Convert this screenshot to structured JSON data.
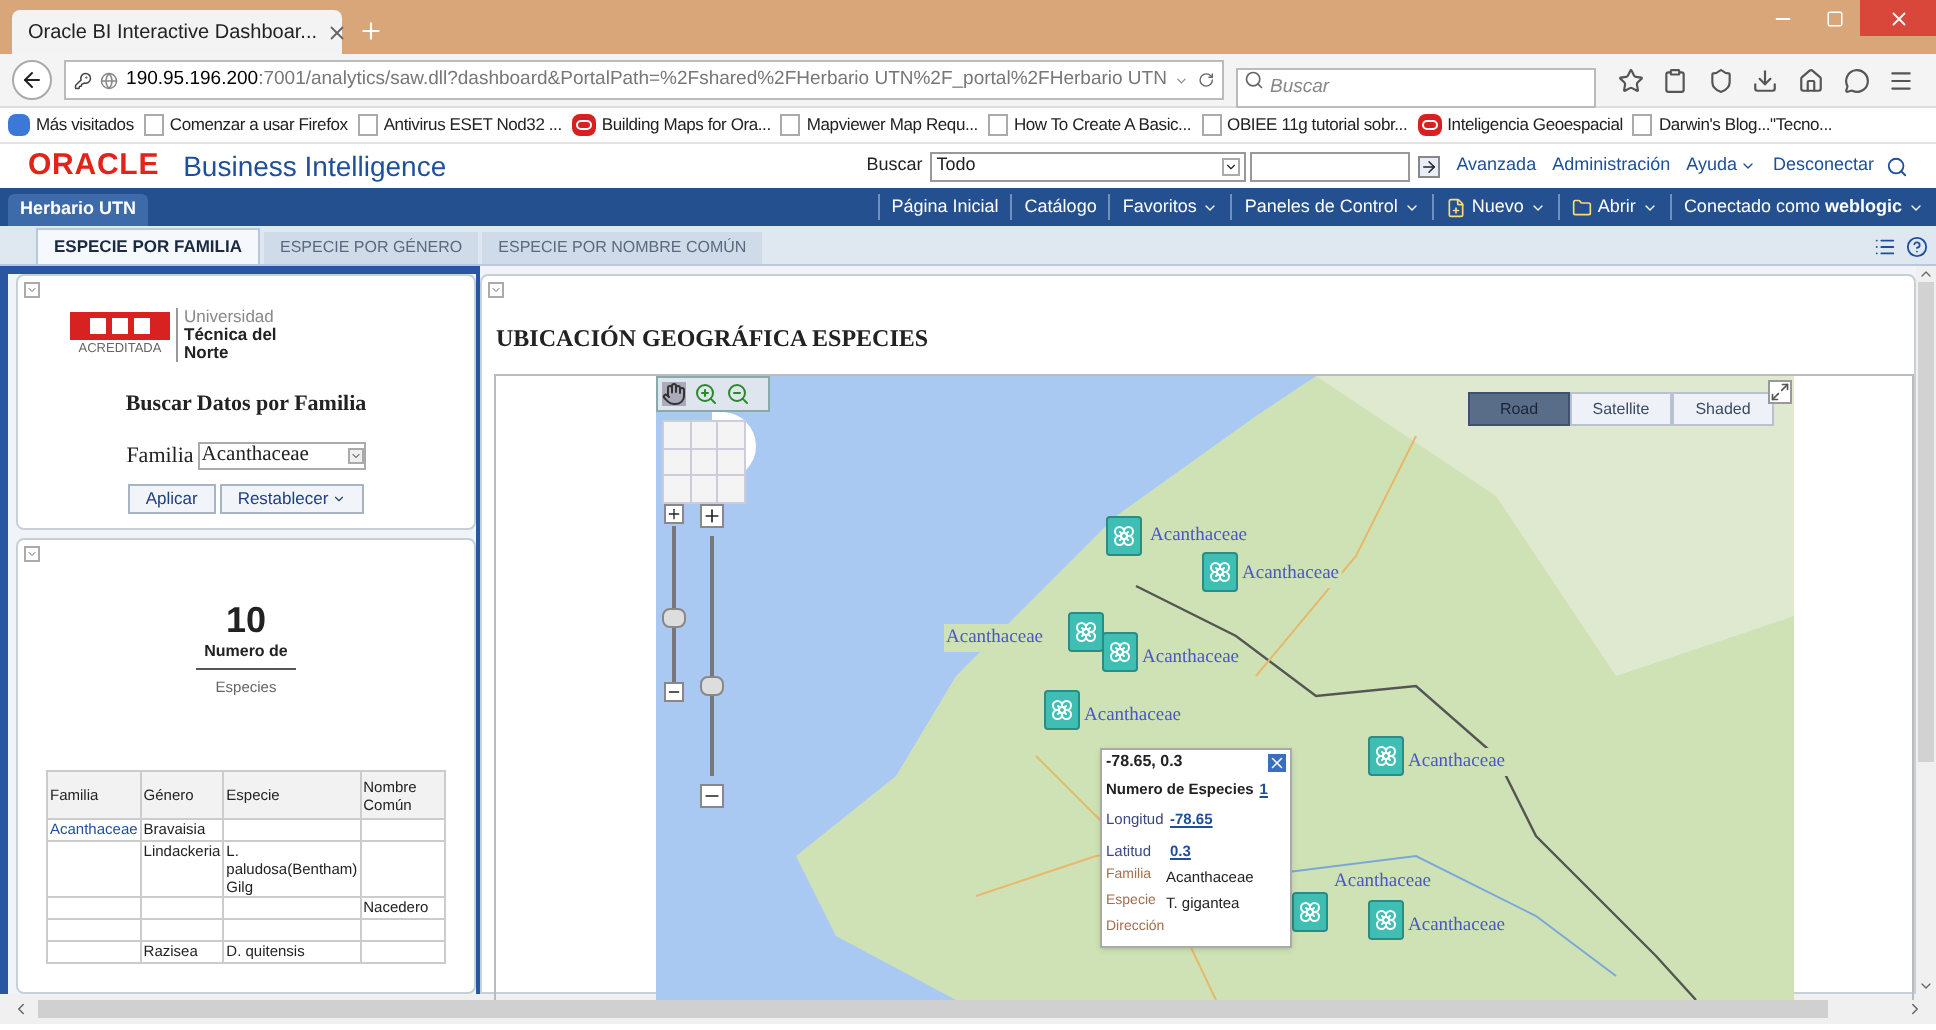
{
  "browser": {
    "tab_title": "Oracle BI Interactive Dashboar...",
    "url_host": "190.95.196.200",
    "url_rest": ":7001/analytics/saw.dll?dashboard&PortalPath=%2Fshared%2FHerbario UTN%2F_portal%2FHerbario UTN",
    "search_placeholder": "Buscar",
    "bookmarks": [
      {
        "label": "Más visitados",
        "kind": "smart"
      },
      {
        "label": "Comenzar a usar Firefox",
        "kind": "page"
      },
      {
        "label": "Antivirus ESET Nod32 ...",
        "kind": "page"
      },
      {
        "label": "Building Maps for Ora...",
        "kind": "oracle"
      },
      {
        "label": "Mapviewer Map Requ...",
        "kind": "page"
      },
      {
        "label": "How To Create A Basic...",
        "kind": "page"
      },
      {
        "label": "OBIEE 11g tutorial sobr...",
        "kind": "page"
      },
      {
        "label": "Inteligencia Geoespacial",
        "kind": "oracle"
      },
      {
        "label": "Darwin's Blog...\"Tecno...",
        "kind": "page"
      }
    ]
  },
  "header": {
    "logo": "ORACLE",
    "product": "Business Intelligence",
    "search_label": "Buscar",
    "search_scope": "Todo",
    "links": [
      {
        "label": "Avanzada",
        "menu": false
      },
      {
        "label": "Administración",
        "menu": false
      },
      {
        "label": "Ayuda",
        "menu": true
      },
      {
        "label": "Desconectar",
        "menu": false
      }
    ]
  },
  "nav": {
    "dashboard": "Herbario UTN",
    "links": [
      {
        "label": "Página Inicial",
        "menu": false,
        "kind": "plain"
      },
      {
        "label": "Catálogo",
        "menu": false,
        "kind": "plain"
      },
      {
        "label": "Favoritos",
        "menu": true,
        "kind": "plain"
      },
      {
        "label": "Paneles de Control",
        "menu": true,
        "kind": "plain"
      },
      {
        "label": "Nuevo",
        "menu": true,
        "kind": "new"
      },
      {
        "label": "Abrir",
        "menu": true,
        "kind": "folder"
      },
      {
        "label": "Conectado como **weblogic**",
        "menu": true,
        "kind": "plain"
      }
    ]
  },
  "tabs": [
    {
      "label": "ESPECIE POR FAMILIA",
      "selected": true
    },
    {
      "label": "ESPECIE POR GÉNERO",
      "selected": false
    },
    {
      "label": "ESPECIE POR NOMBRE COMÚN",
      "selected": false
    }
  ],
  "filter": {
    "logo": {
      "line1": "Universidad",
      "line2": "Técnica del",
      "line3": "Norte",
      "badge": "ACREDITADA"
    },
    "title": "Buscar Datos por Familia",
    "field_label": "Familia",
    "field_value": "Acanthaceae",
    "buttons": [
      {
        "label": "Aplicar",
        "menu": false
      },
      {
        "label": "Restablecer",
        "menu": true
      }
    ]
  },
  "metric": {
    "value": "10",
    "label": "Numero de",
    "sublabel": "Especies"
  },
  "table": {
    "columns": [
      "Familia",
      "Género",
      "Especie",
      "Nombre Común"
    ],
    "rows": [
      [
        "Acanthaceae",
        "Bravaisia",
        "",
        ""
      ],
      [
        "",
        "Lindackeria",
        "L. paludosa(Bentham) Gilg",
        ""
      ],
      [
        "",
        "",
        "",
        "Nacedero"
      ],
      [
        "",
        "",
        "",
        ""
      ],
      [
        "",
        "Razisea",
        "D. quitensis",
        ""
      ]
    ]
  },
  "map": {
    "title": "UBICACIÓN GEOGRÁFICA ESPECIES",
    "zoom_sliders": [
      {
        "level": 0.39
      },
      {
        "level": 0.36
      }
    ],
    "map_types": [
      {
        "label": "Road",
        "selected": true
      },
      {
        "label": "Satellite",
        "selected": false
      },
      {
        "label": "Shaded",
        "selected": false
      }
    ],
    "markers": [
      {
        "label": "Acanthaceae"
      },
      {
        "label": "Acanthaceae"
      },
      {
        "label": "Acanthaceae"
      },
      {
        "label": "Acanthaceae"
      },
      {
        "label": "Acanthaceae"
      },
      {
        "label": "Acanthaceae"
      },
      {
        "label": "Acanthaceae"
      },
      {
        "label": "Acanthaceae"
      }
    ],
    "popup": {
      "title": "-78.65, 0.3",
      "count_label": "Numero de Especies",
      "count": "1",
      "fields": [
        {
          "label": "Longitud",
          "value": "-78.65",
          "kind": "link"
        },
        {
          "label": "Latitud",
          "value": "0.3",
          "kind": "link"
        },
        {
          "label": "Familia",
          "value": "Acanthaceae",
          "kind": "attr"
        },
        {
          "label": "Especie",
          "value": "T. gigantea",
          "kind": "attr"
        },
        {
          "label": "Dirección",
          "kind": "attr"
        }
      ]
    }
  }
}
